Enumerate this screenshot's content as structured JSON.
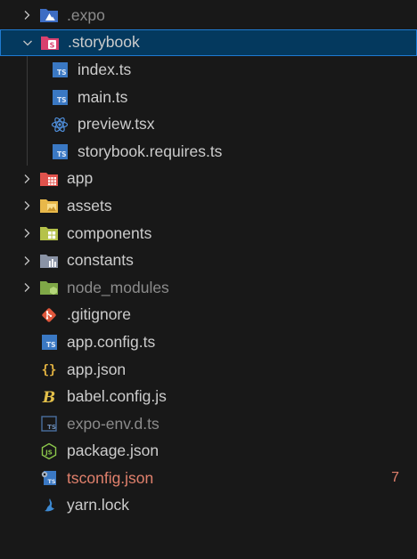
{
  "explorer": {
    "items": [
      {
        "label": ".expo",
        "icon": "folder-expo-icon",
        "expanded": false
      },
      {
        "label": ".storybook",
        "icon": "folder-storybook-icon",
        "expanded": true,
        "selected": true
      },
      {
        "label": "index.ts",
        "icon": "typescript-file-icon"
      },
      {
        "label": "main.ts",
        "icon": "typescript-file-icon"
      },
      {
        "label": "preview.tsx",
        "icon": "react-file-icon"
      },
      {
        "label": "storybook.requires.ts",
        "icon": "typescript-file-icon"
      },
      {
        "label": "app",
        "icon": "folder-app-icon",
        "expanded": false
      },
      {
        "label": "assets",
        "icon": "folder-assets-icon",
        "expanded": false
      },
      {
        "label": "components",
        "icon": "folder-components-icon",
        "expanded": false
      },
      {
        "label": "constants",
        "icon": "folder-constants-icon",
        "expanded": false
      },
      {
        "label": "node_modules",
        "icon": "folder-node-icon",
        "expanded": false,
        "dimmed": true
      },
      {
        "label": ".gitignore",
        "icon": "git-icon"
      },
      {
        "label": "app.config.ts",
        "icon": "typescript-file-icon"
      },
      {
        "label": "app.json",
        "icon": "json-braces-icon"
      },
      {
        "label": "babel.config.js",
        "icon": "babel-icon"
      },
      {
        "label": "expo-env.d.ts",
        "icon": "typescript-def-icon",
        "dimmed": true
      },
      {
        "label": "package.json",
        "icon": "nodejs-icon"
      },
      {
        "label": "tsconfig.json",
        "icon": "tsconfig-icon",
        "error": true,
        "badge": "7"
      },
      {
        "label": "yarn.lock",
        "icon": "yarn-icon"
      }
    ]
  },
  "colors": {
    "background": "#181818",
    "selection": "#04395e",
    "selection_border": "#1f7ad1",
    "text": "#cccccc",
    "dimmed_text": "#8b8b8b",
    "error_text": "#e0806c"
  }
}
